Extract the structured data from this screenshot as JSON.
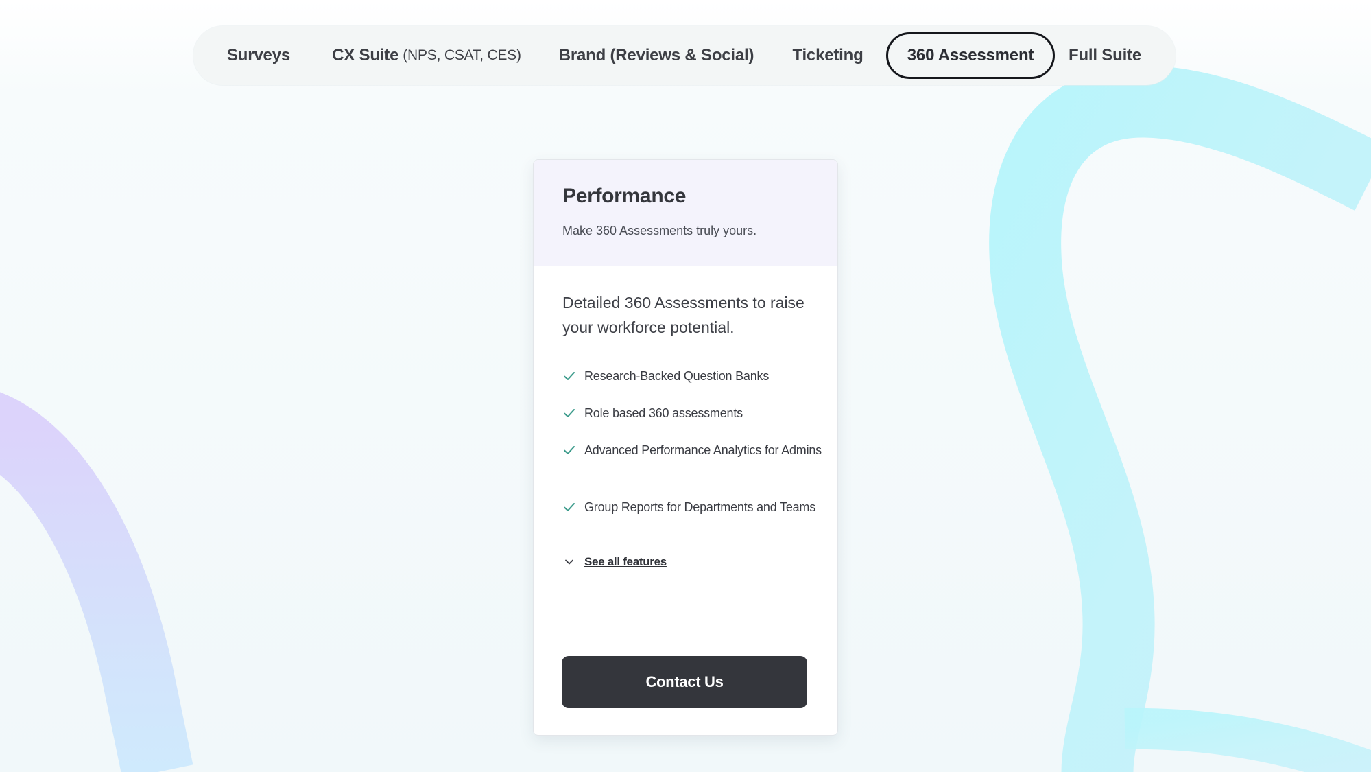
{
  "tabs": {
    "surveys": "Surveys",
    "cx_suite": "CX Suite",
    "cx_suite_note": "(NPS, CSAT, CES)",
    "brand": "Brand (Reviews & Social)",
    "ticketing": "Ticketing",
    "assessment": "360 Assessment",
    "full_suite": "Full Suite",
    "active": "360 Assessment"
  },
  "plan": {
    "name": "Performance",
    "tagline": "Make 360 Assessments truly yours.",
    "description": "Detailed 360 Assessments to raise your workforce potential.",
    "features": [
      "Research-Backed Question Banks",
      "Role based 360 assessments",
      "Advanced Performance Analytics for Admins",
      "Group Reports for Departments and Teams"
    ],
    "see_all_label": "See all features",
    "cta_label": "Contact Us"
  },
  "icons": {
    "check": "check-icon",
    "chevron": "chevron-down-icon"
  },
  "colors": {
    "check": "#3a9a8a",
    "cta_bg": "#34363c",
    "header_bg": "#f4f3fc",
    "active_tab_border": "#15171c"
  }
}
